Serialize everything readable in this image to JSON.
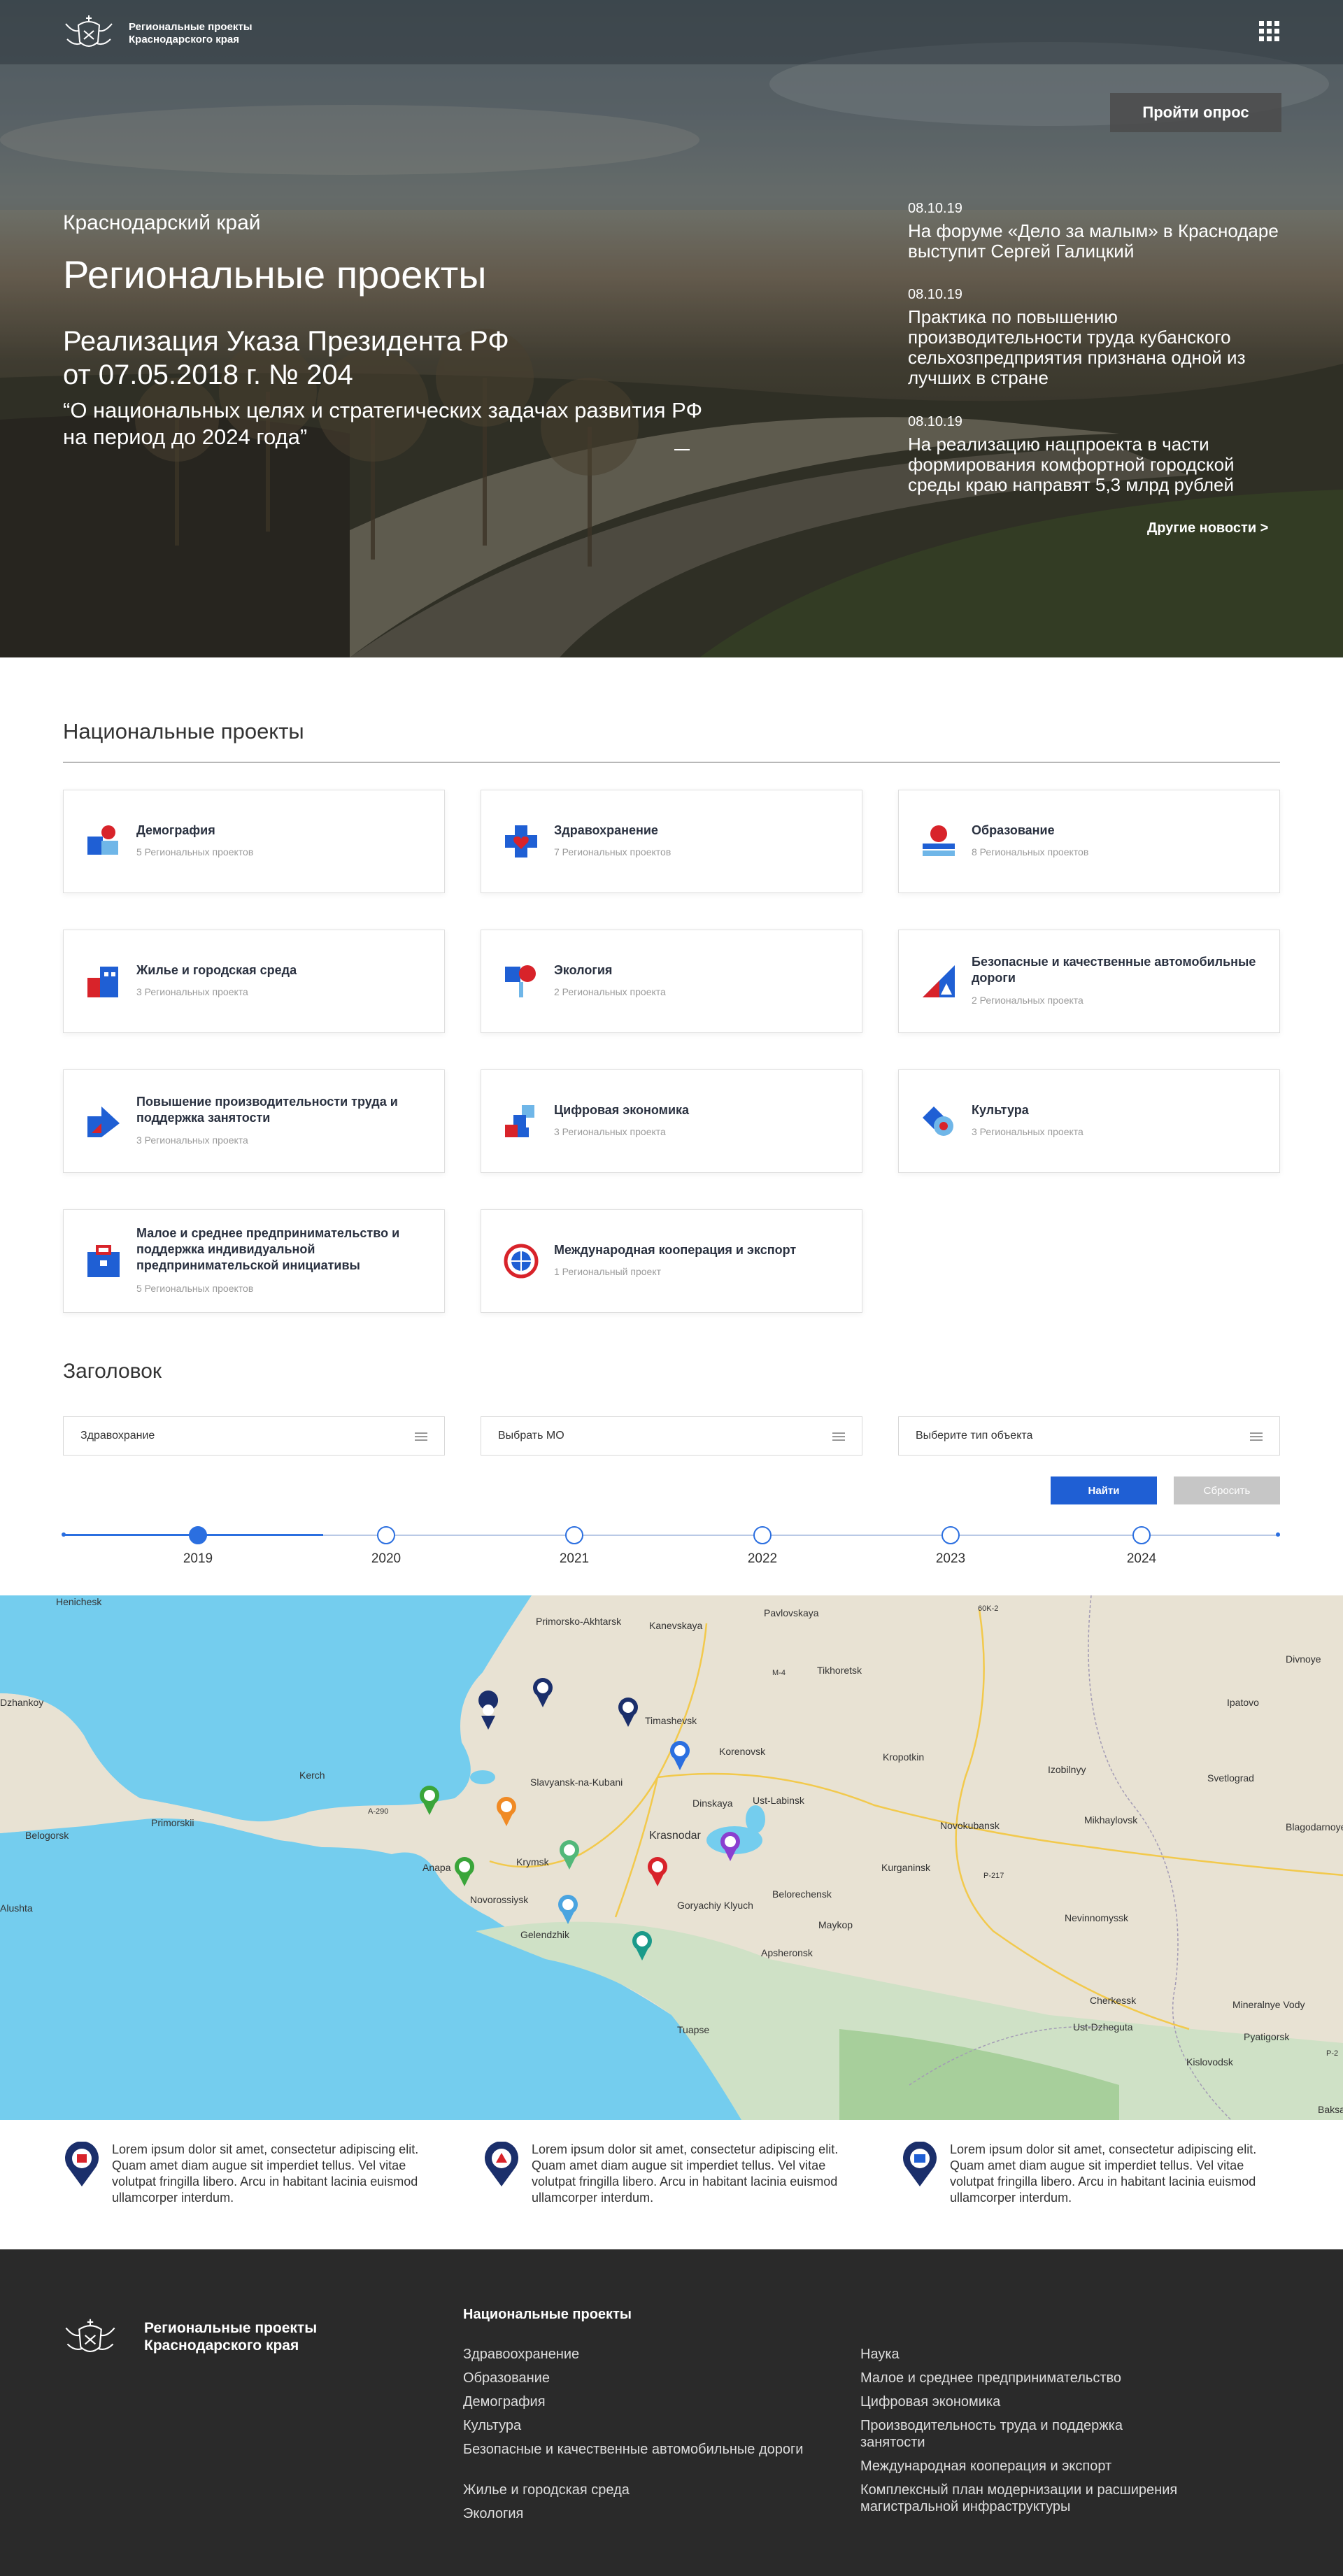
{
  "header": {
    "logo_line1": "Региональные проекты",
    "logo_line2": "Краснодарского края",
    "menu_icon": "grid-icon",
    "survey_button": "Пройти опрос"
  },
  "hero": {
    "region": "Краснодарский край",
    "title": "Региональные проекты",
    "subtitle_line1": "Реализация Указа Президента РФ",
    "subtitle_line2": "от 07.05.2018 г. № 204",
    "quote_line1": "“О национальных целях и стратегических задачах развития РФ",
    "quote_line2": "на период до 2024 года”",
    "news": [
      {
        "date": "08.10.19",
        "title": "На форуме «Дело за малым» в Краснодаре выступит Сергей Галицкий"
      },
      {
        "date": "08.10.19",
        "title": "Практика по повышению производительности труда кубанского сельхозпредприятия признана одной из лучших в стране"
      },
      {
        "date": "08.10.19",
        "title": "На реализацию нацпроекта в части формирования комфортной городской среды краю направят 5,3 млрд рублей"
      }
    ],
    "more_news": "Другие новости  >"
  },
  "projects": {
    "title": "Национальные проекты",
    "cards": [
      {
        "name": "Демография",
        "count": "5 Региональных проектов",
        "icon": "demography-icon"
      },
      {
        "name": "Здравохранение",
        "count": "7 Региональных проектов",
        "icon": "healthcare-icon"
      },
      {
        "name": "Образование",
        "count": "8 Региональных проектов",
        "icon": "education-icon"
      },
      {
        "name": "Жилье и городская среда",
        "count": "3 Региональных проекта",
        "icon": "housing-icon"
      },
      {
        "name": "Экология",
        "count": "2 Региональных проекта",
        "icon": "ecology-icon"
      },
      {
        "name": "Безопасные и качественные автомобильные дороги",
        "count": "2 Региональных проекта",
        "icon": "roads-icon"
      },
      {
        "name": "Повышение производительности труда и поддержка занятости",
        "count": "3 Региональных проекта",
        "icon": "productivity-icon"
      },
      {
        "name": "Цифровая экономика",
        "count": "3 Региональных проекта",
        "icon": "digital-economy-icon"
      },
      {
        "name": "Культура",
        "count": "3 Региональных проекта",
        "icon": "culture-icon"
      },
      {
        "name": "Малое и среднее предпринимательство и поддержка индивидуальной предпринимательской инициативы",
        "count": "5 Региональных проектов",
        "icon": "business-icon"
      },
      {
        "name": "Международная кооперация и экспорт",
        "count": "1 Региональный проект",
        "icon": "export-icon"
      }
    ]
  },
  "filters": {
    "title": "Заголовок",
    "select1": "Здравохрание",
    "select2": "Выбрать МО",
    "select3": "Выберите тип объекта",
    "find_button": "Найти",
    "reset_button": "Сбросить",
    "years": [
      "2019",
      "2020",
      "2021",
      "2022",
      "2023",
      "2024"
    ],
    "selected_year": "2019"
  },
  "map": {
    "labels": [
      "Henichesk",
      "Primorsko-Akhtarsk",
      "Kanevskaya",
      "Pavlovskaya",
      "60K-2",
      "Tikhoretsk",
      "Divnoye",
      "Dzhankoy",
      "M-4",
      "Timashevsk",
      "Ipatovo",
      "Korenovsk",
      "Kropotkin",
      "Izobilnyy",
      "Kerch",
      "Slavyansk-na-Kubani",
      "Svetlograd",
      "A-290",
      "Dinskaya",
      "Ust-Labinsk",
      "Belogorsk",
      "Primorskii",
      "Mikhaylovsk",
      "Novokubansk",
      "Blagodarnoye",
      "Krasnodar",
      "Anapa",
      "Krymsk",
      "Kurganinsk",
      "P-217",
      "Novorossiysk",
      "Goryachiy Klyuch",
      "Belorechensk",
      "Alushta",
      "Gelendzhik",
      "Maykop",
      "Nevinnomyssk",
      "Apsheronsk",
      "Cherkessk",
      "Mineralnye Vody",
      "Ust-Dzheguta",
      "Pyatigorsk",
      "Tuapse",
      "Kislovodsk",
      "P-2",
      "Baksa"
    ],
    "water_color": "#74cdee",
    "land_color": "#e8e2d3"
  },
  "legend": [
    {
      "text": "Lorem ipsum dolor sit amet, consectetur adipiscing elit. Quam amet diam augue sit imperdiet tellus. Vel vitae volutpat fringilla libero. Arcu in habitant lacinia euismod ullamcorper interdum."
    },
    {
      "text": "Lorem ipsum dolor sit amet, consectetur adipiscing elit. Quam amet diam augue sit imperdiet tellus. Vel vitae volutpat fringilla libero. Arcu in habitant lacinia euismod ullamcorper interdum."
    },
    {
      "text": "Lorem ipsum dolor sit amet, consectetur adipiscing elit. Quam amet diam augue sit imperdiet tellus. Vel vitae volutpat fringilla libero. Arcu in habitant lacinia euismod ullamcorper interdum."
    }
  ],
  "footer": {
    "name_line1": "Региональные проекты",
    "name_line2": "Краснодарского края",
    "heading": "Национальные проекты",
    "col1": [
      "Здравоохранение",
      "Образование",
      "Демография",
      "Культура",
      "Безопасные и качественные автомобильные дороги",
      "Жилье и городская среда",
      "Экология"
    ],
    "col2": [
      "Наука",
      "Малое и среднее предпринимательство",
      "Цифровая экономика",
      "Производительность труда и поддержка занятости",
      "Международная кооперация и экспорт",
      "Комплексный план модернизации и расширения магистральной инфраструктуры"
    ]
  },
  "colors": {
    "accent": "#1f5fd4",
    "footer_bg": "#2a2a2a",
    "pin_navy": "#1b2f6b",
    "pin_red": "#d8232a"
  }
}
